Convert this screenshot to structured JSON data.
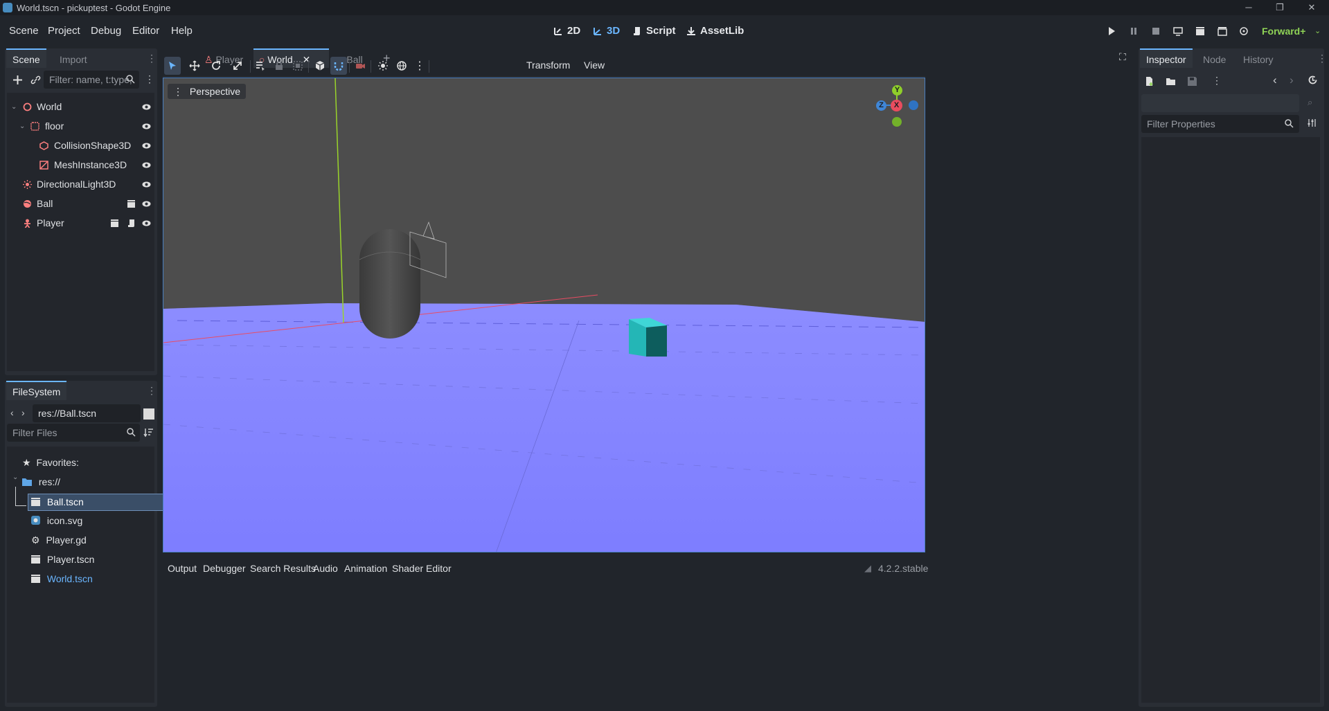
{
  "window": {
    "title": "World.tscn - pickuptest - Godot Engine",
    "controls": [
      "─",
      "❐",
      "✕"
    ]
  },
  "menu": {
    "items": [
      "Scene",
      "Project",
      "Debug",
      "Editor",
      "Help"
    ]
  },
  "workspaces": [
    {
      "label": "2D",
      "active": false
    },
    {
      "label": "3D",
      "active": true
    },
    {
      "label": "Script",
      "active": false
    },
    {
      "label": "AssetLib",
      "active": false
    }
  ],
  "renderer": "Forward+",
  "scene_dock": {
    "tabs": [
      "Scene",
      "Import"
    ],
    "filter_placeholder": "Filter: name, t:type,",
    "tree": [
      {
        "label": "World",
        "icon": "node3d-icon",
        "color": "#fc7f7f"
      },
      {
        "label": "floor",
        "icon": "static-body-icon",
        "color": "#fc7f7f"
      },
      {
        "label": "CollisionShape3D",
        "icon": "collision-shape-icon",
        "color": "#fc7f7f"
      },
      {
        "label": "MeshInstance3D",
        "icon": "mesh-instance-icon",
        "color": "#fc7f7f"
      },
      {
        "label": "DirectionalLight3D",
        "icon": "light-icon",
        "color": "#fc7f7f"
      },
      {
        "label": "Ball",
        "icon": "rigid-body-icon",
        "color": "#fc7f7f"
      },
      {
        "label": "Player",
        "icon": "character-body-icon",
        "color": "#fc7f7f"
      }
    ]
  },
  "filesystem_dock": {
    "tab": "FileSystem",
    "path": "res://Ball.tscn",
    "filter_placeholder": "Filter Files",
    "items": [
      {
        "label": "Favorites:",
        "icon": "star-icon"
      },
      {
        "label": "res://",
        "icon": "folder-icon"
      },
      {
        "label": "Ball.tscn",
        "icon": "scene-file-icon",
        "selected": true
      },
      {
        "label": "icon.svg",
        "icon": "image-file-icon"
      },
      {
        "label": "Player.gd",
        "icon": "gear-icon"
      },
      {
        "label": "Player.tscn",
        "icon": "scene-file-icon"
      },
      {
        "label": "World.tscn",
        "icon": "scene-file-icon",
        "highlight": true
      }
    ]
  },
  "editor_tabs": [
    {
      "label": "Player",
      "active": false
    },
    {
      "label": "World",
      "active": true
    },
    {
      "label": "Ball",
      "active": false
    }
  ],
  "viewport_toolbar": {
    "menus": [
      "Transform",
      "View"
    ]
  },
  "viewport": {
    "perspective_label": "Perspective",
    "gizmo_labels": {
      "y": "Y",
      "x": "X",
      "z": "Z"
    }
  },
  "bottom_panel": {
    "tabs": [
      "Output",
      "Debugger",
      "Search Results",
      "Audio",
      "Animation",
      "Shader Editor"
    ],
    "version": "4.2.2.stable"
  },
  "inspector_dock": {
    "tabs": [
      "Inspector",
      "Node",
      "History"
    ],
    "filter_placeholder": "Filter Properties"
  },
  "colors": {
    "accent": "#6bb6ff",
    "node_red": "#fc7f7f",
    "renderer_green": "#8fd356",
    "floor": "#8484ff",
    "sky": "#4d4d4d"
  }
}
